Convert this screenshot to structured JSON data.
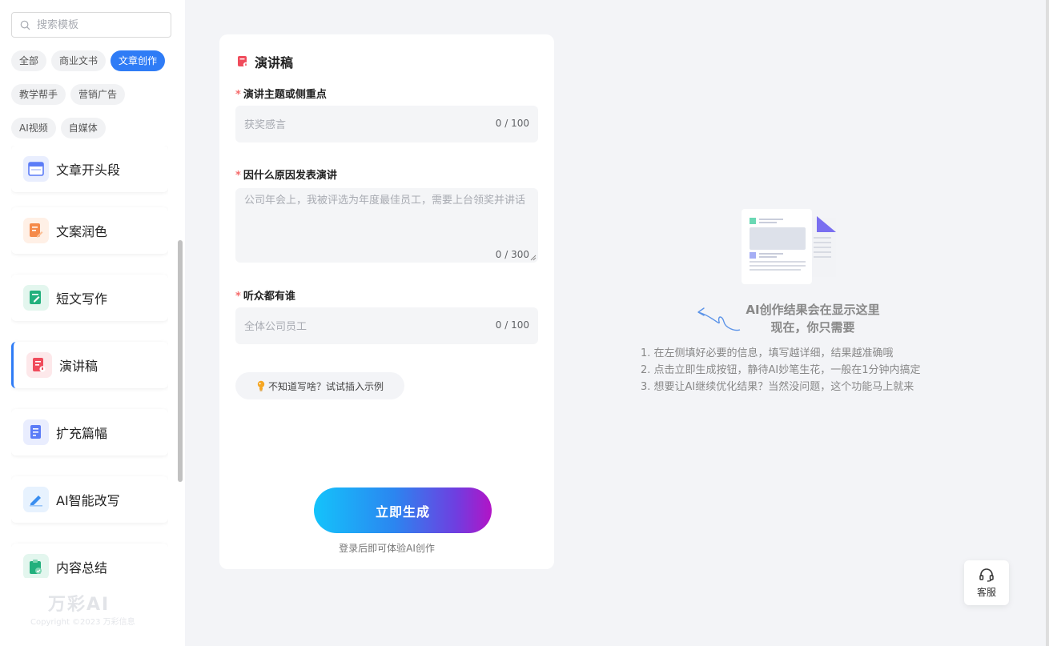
{
  "sidebar": {
    "search": {
      "placeholder": "搜索模板"
    },
    "categories": [
      {
        "label": "全部",
        "active": false
      },
      {
        "label": "商业文书",
        "active": false
      },
      {
        "label": "文章创作",
        "active": true
      },
      {
        "label": "教学帮手",
        "active": false
      },
      {
        "label": "营销广告",
        "active": false
      },
      {
        "label": "AI视频",
        "active": false
      },
      {
        "label": "自媒体",
        "active": false
      }
    ],
    "tools": [
      {
        "label": "文章开头段",
        "icon": "layout-icon",
        "color": "#5b7cf7"
      },
      {
        "label": "文案润色",
        "icon": "edit-doc-icon",
        "color": "#f58a4a"
      },
      {
        "label": "短文写作",
        "icon": "write-icon",
        "color": "#22b07d"
      },
      {
        "label": "演讲稿",
        "icon": "speech-doc-icon",
        "color": "#f04b5b"
      },
      {
        "label": "扩充篇幅",
        "icon": "expand-doc-icon",
        "color": "#5b7cf7"
      },
      {
        "label": "AI智能改写",
        "icon": "pen-icon",
        "color": "#3a8ef0"
      },
      {
        "label": "内容总结",
        "icon": "clipboard-check-icon",
        "color": "#22b07d"
      }
    ],
    "brand": "万彩AI",
    "copyright": "Copyright ©2023 万彩信息"
  },
  "form": {
    "title": "演讲稿",
    "fields": [
      {
        "label": "演讲主题或侧重点",
        "placeholder": "获奖感言",
        "counter": "0 / 100"
      },
      {
        "label": "因什么原因发表演讲",
        "placeholder": "公司年会上，我被评选为年度最佳员工，需要上台领奖并讲话",
        "counter": "0 / 300"
      },
      {
        "label": "听众都有谁",
        "placeholder": "全体公司员工",
        "counter": "0 / 100"
      }
    ],
    "example_button": "不知道写啥？试试插入示例",
    "generate_button": "立即生成",
    "generate_hint": "登录后即可体验AI创作"
  },
  "result": {
    "title_line1": "AI创作结果会在显示这里",
    "title_line2": "现在，你只需要",
    "tips": [
      "1. 在左侧填好必要的信息，填写越详细，结果越准确哦",
      "2. 点击立即生成按钮，静待AI妙笔生花，一般在1分钟内搞定",
      "3. 想要让AI继续优化结果？当然没问题，这个功能马上就来"
    ]
  },
  "service": {
    "label": "客服"
  },
  "colors": {
    "accent": "#2f7cf6",
    "required": "#f56c6c"
  }
}
